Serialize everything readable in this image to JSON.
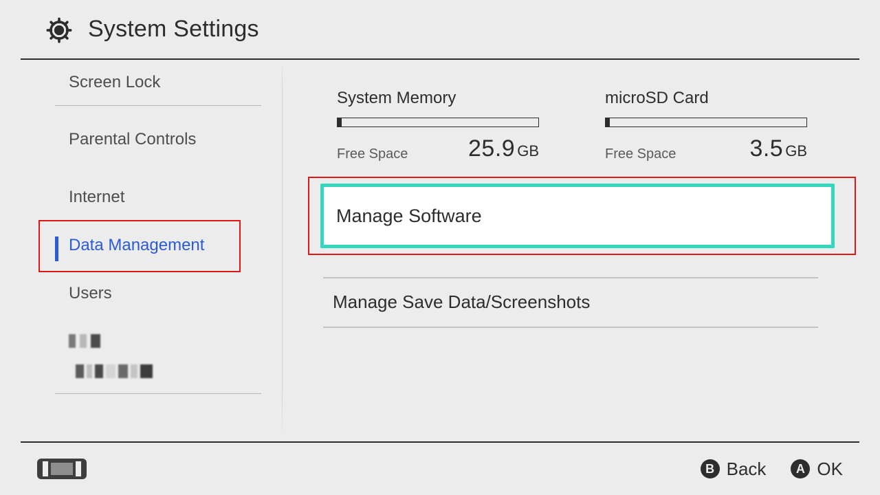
{
  "header": {
    "title": "System Settings"
  },
  "sidebar": {
    "items": [
      {
        "label": "Screen Lock"
      },
      {
        "label": "Parental Controls"
      },
      {
        "label": "Internet"
      },
      {
        "label": "Data Management"
      },
      {
        "label": "Users"
      }
    ],
    "selected_index": 3
  },
  "storage": {
    "system": {
      "title": "System Memory",
      "free_label": "Free Space",
      "free_value": "25.9",
      "free_unit": "GB",
      "used_pct": 2
    },
    "sd": {
      "title": "microSD Card",
      "free_label": "Free Space",
      "free_value": "3.5",
      "free_unit": "GB",
      "used_pct": 2
    }
  },
  "options": [
    {
      "label": "Manage Software",
      "highlighted": true
    },
    {
      "label": "Manage Save Data/Screenshots",
      "highlighted": false
    }
  ],
  "footer": {
    "back": {
      "button": "B",
      "label": "Back"
    },
    "ok": {
      "button": "A",
      "label": "OK"
    }
  }
}
